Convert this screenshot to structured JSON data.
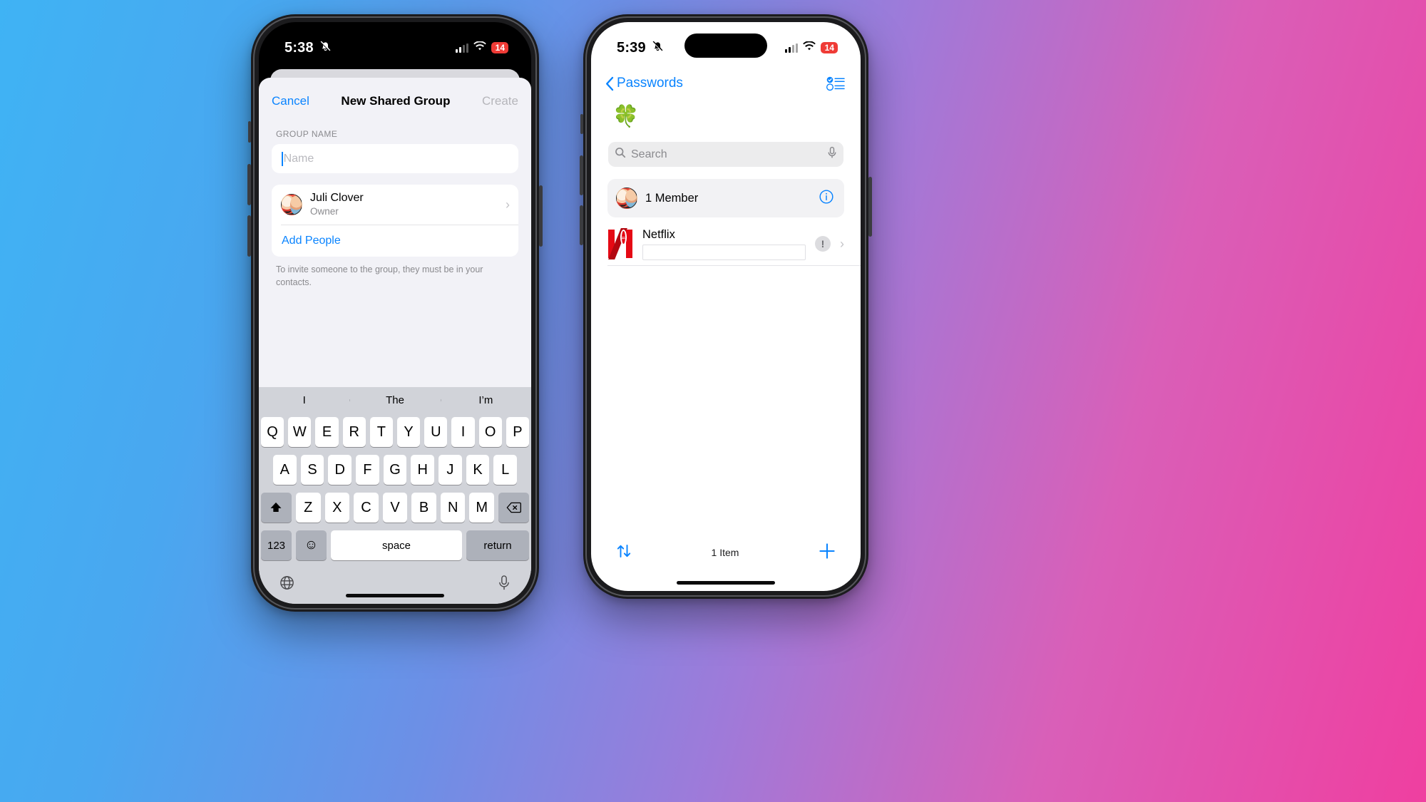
{
  "left_phone": {
    "status_bar": {
      "time": "5:38",
      "silent_icon": "bell-slash-icon",
      "signal_icon": "cellular-bars-icon",
      "wifi_icon": "wifi-icon",
      "battery_level": "14",
      "battery_low_color": "#ef3b36"
    },
    "sheet": {
      "cancel_label": "Cancel",
      "title": "New Shared Group",
      "create_label": "Create",
      "section_header": "GROUP NAME",
      "name_placeholder": "Name",
      "name_value": "",
      "owner": {
        "name": "Juli Clover",
        "role": "Owner"
      },
      "add_people_label": "Add People",
      "footer_note": "To invite someone to the group, they must be in your contacts."
    },
    "keyboard": {
      "suggestions": [
        "I",
        "The",
        "I’m"
      ],
      "row1": [
        "Q",
        "W",
        "E",
        "R",
        "T",
        "Y",
        "U",
        "I",
        "O",
        "P"
      ],
      "row2": [
        "A",
        "S",
        "D",
        "F",
        "G",
        "H",
        "J",
        "K",
        "L"
      ],
      "row3": [
        "Z",
        "X",
        "C",
        "V",
        "B",
        "N",
        "M"
      ],
      "shift_icon": "shift-up-icon",
      "delete_icon": "backspace-icon",
      "numbers_label": "123",
      "emoji_icon": "smiley-icon",
      "space_label": "space",
      "return_label": "return",
      "globe_icon": "globe-icon",
      "dictation_icon": "microphone-icon"
    }
  },
  "right_phone": {
    "status_bar": {
      "time": "5:39",
      "silent_icon": "bell-slash-icon",
      "signal_icon": "cellular-bars-icon",
      "wifi_icon": "wifi-icon",
      "battery_level": "14",
      "battery_low_color": "#ef3b36"
    },
    "nav": {
      "back_label": "Passwords",
      "back_icon": "chevron-left-icon",
      "list_icon": "checklist-icon"
    },
    "group": {
      "emoji": "🍀",
      "emoji_name": "four-leaf-clover-icon"
    },
    "search": {
      "placeholder": "Search",
      "value": "",
      "search_icon": "magnifier-icon",
      "dictation_icon": "microphone-icon"
    },
    "member_card": {
      "label": "1 Member",
      "avatar_name": "member-avatar",
      "info_icon": "info-circle-icon"
    },
    "items": [
      {
        "title": "Netflix",
        "logo_name": "netflix-logo-icon",
        "shared_badge_icon": "shared-people-icon",
        "warning_icon": "exclamation-badge-icon",
        "chevron_icon": "chevron-right-icon"
      }
    ],
    "toolbar": {
      "sort_icon": "sort-arrows-icon",
      "count_label": "1 Item",
      "add_icon": "plus-icon"
    }
  },
  "theme": {
    "accent_blue": "#0a84ff",
    "netflix_red": "#e50914",
    "sheet_bg": "#f2f2f7",
    "keyboard_bg": "#d1d3d9"
  }
}
